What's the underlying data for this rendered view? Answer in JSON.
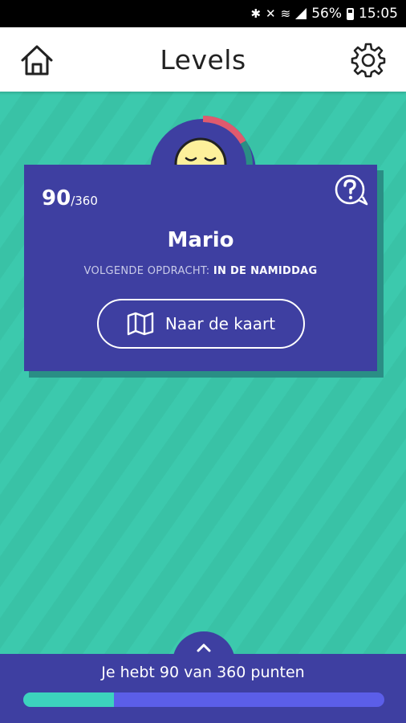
{
  "status_bar": {
    "battery": "56%",
    "time": "15:05"
  },
  "header": {
    "title": "Levels",
    "home_icon": "home-icon",
    "settings_icon": "gear-icon"
  },
  "card": {
    "score": "90",
    "score_total": "/360",
    "name": "Mario",
    "next_label": "VOLGENDE OPDRACHT:",
    "next_value": "IN DE NAMIDDAG",
    "map_button_label": "Naar de kaart",
    "level_progress_fraction": 0.25
  },
  "bottom": {
    "points_text": "Je hebt 90 van 360 punten",
    "progress_fraction": 0.25
  },
  "colors": {
    "accent_teal": "#3cc9ad",
    "card_blue": "#3e3fa1",
    "ring_red": "#e05a6e",
    "progress_blue": "#5b5ee8"
  }
}
